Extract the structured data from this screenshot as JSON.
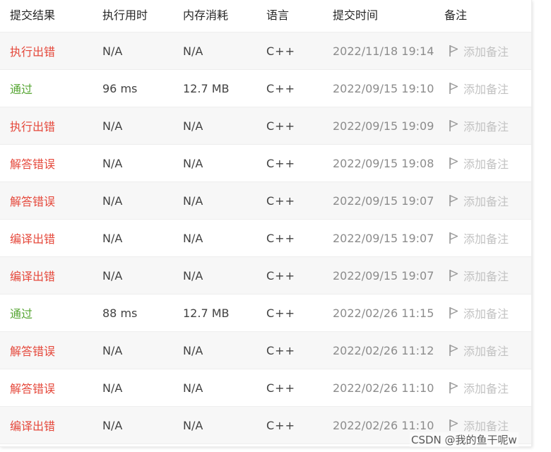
{
  "table": {
    "headers": {
      "status": "提交结果",
      "runtime": "执行用时",
      "memory": "内存消耗",
      "language": "语言",
      "submitted": "提交时间",
      "note": "备注"
    },
    "add_note_label": "添加备注",
    "rows": [
      {
        "status": "执行出错",
        "type": "error",
        "runtime": "N/A",
        "memory": "N/A",
        "language": "C++",
        "submitted": "2022/11/18 19:14"
      },
      {
        "status": "通过",
        "type": "ok",
        "runtime": "96 ms",
        "memory": "12.7 MB",
        "language": "C++",
        "submitted": "2022/09/15 19:10"
      },
      {
        "status": "执行出错",
        "type": "error",
        "runtime": "N/A",
        "memory": "N/A",
        "language": "C++",
        "submitted": "2022/09/15 19:09"
      },
      {
        "status": "解答错误",
        "type": "error",
        "runtime": "N/A",
        "memory": "N/A",
        "language": "C++",
        "submitted": "2022/09/15 19:08"
      },
      {
        "status": "解答错误",
        "type": "error",
        "runtime": "N/A",
        "memory": "N/A",
        "language": "C++",
        "submitted": "2022/09/15 19:07"
      },
      {
        "status": "编译出错",
        "type": "error",
        "runtime": "N/A",
        "memory": "N/A",
        "language": "C++",
        "submitted": "2022/09/15 19:07"
      },
      {
        "status": "编译出错",
        "type": "error",
        "runtime": "N/A",
        "memory": "N/A",
        "language": "C++",
        "submitted": "2022/09/15 19:07"
      },
      {
        "status": "通过",
        "type": "ok",
        "runtime": "88 ms",
        "memory": "12.7 MB",
        "language": "C++",
        "submitted": "2022/02/26 11:15"
      },
      {
        "status": "解答错误",
        "type": "error",
        "runtime": "N/A",
        "memory": "N/A",
        "language": "C++",
        "submitted": "2022/02/26 11:12"
      },
      {
        "status": "解答错误",
        "type": "error",
        "runtime": "N/A",
        "memory": "N/A",
        "language": "C++",
        "submitted": "2022/02/26 11:10"
      },
      {
        "status": "编译出错",
        "type": "error",
        "runtime": "N/A",
        "memory": "N/A",
        "language": "C++",
        "submitted": "2022/02/26 11:10"
      }
    ]
  },
  "watermark": "CSDN @我的鱼干呢w",
  "colors": {
    "error": "#e5483b",
    "ok": "#55a532",
    "muted": "#8c8c8c",
    "note": "#c2c2c2",
    "stripe": "#f7f7f7"
  },
  "icons": {
    "note": "flag-icon"
  }
}
